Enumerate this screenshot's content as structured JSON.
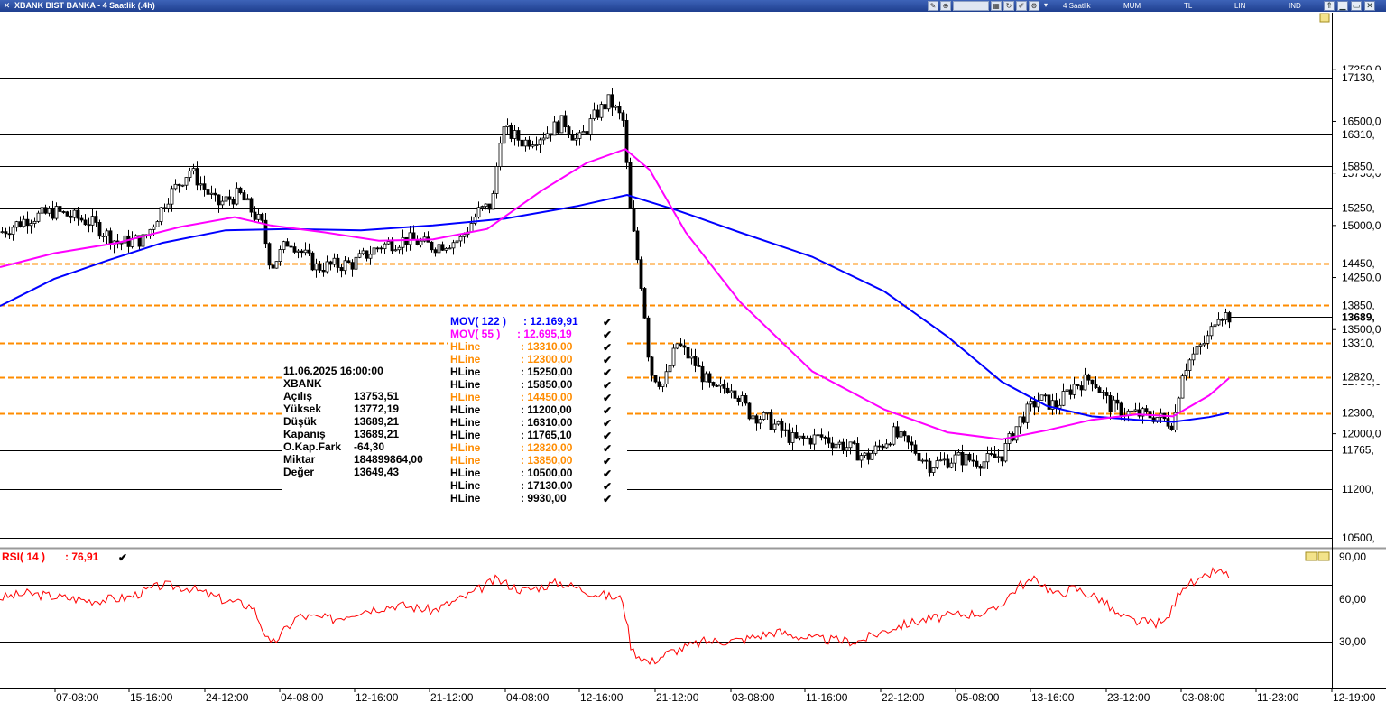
{
  "window": {
    "title": "XBANK BIST BANKA - 4 Saatlik (.4h)",
    "period_label": "4 Saatlik",
    "chart_type_label": "MUM",
    "currency_label": "TL",
    "scale_label": "LIN",
    "indicator_label": "IND"
  },
  "price_axis": {
    "ticks": [
      "17250,0",
      "16500,0",
      "15750,0",
      "15000,0",
      "14250,0",
      "13500,0",
      "12750,0",
      "12000,0"
    ],
    "current_price_label": "13689,",
    "hline_labels": [
      "17130,",
      "16310,",
      "15850,",
      "15250,",
      "14450,",
      "13850,",
      "13310,",
      "12820,",
      "12300,",
      "11765,",
      "11200,",
      "10500,"
    ]
  },
  "time_axis": {
    "labels": [
      "07-08:00",
      "15-16:00",
      "24-12:00",
      "04-08:00",
      "12-16:00",
      "21-12:00",
      "04-08:00",
      "12-16:00",
      "21-12:00",
      "03-08:00",
      "11-16:00",
      "22-12:00",
      "05-08:00",
      "13-16:00",
      "23-12:00",
      "03-08:00",
      "11-23:00",
      "12-19:00"
    ]
  },
  "legend": {
    "items": [
      {
        "name": "MOV( 122 )",
        "value": ": 12.169,91",
        "color": "#0000ff"
      },
      {
        "name": "MOV( 55 )",
        "value": ": 12.695,19",
        "color": "#ff00ff"
      },
      {
        "name": "HLine",
        "value": ": 13310,00",
        "color": "#ff8c00"
      },
      {
        "name": "HLine",
        "value": ": 12300,00",
        "color": "#ff8c00"
      },
      {
        "name": "HLine",
        "value": ": 15250,00",
        "color": "#000000"
      },
      {
        "name": "HLine",
        "value": ": 15850,00",
        "color": "#000000"
      },
      {
        "name": "HLine",
        "value": ": 14450,00",
        "color": "#ff8c00"
      },
      {
        "name": "HLine",
        "value": ": 11200,00",
        "color": "#000000"
      },
      {
        "name": "HLine",
        "value": ": 16310,00",
        "color": "#000000"
      },
      {
        "name": "HLine",
        "value": ": 11765,10",
        "color": "#000000"
      },
      {
        "name": "HLine",
        "value": ": 12820,00",
        "color": "#ff8c00"
      },
      {
        "name": "HLine",
        "value": ": 13850,00",
        "color": "#ff8c00"
      },
      {
        "name": "HLine",
        "value": ": 10500,00",
        "color": "#000000"
      },
      {
        "name": "HLine",
        "value": ": 17130,00",
        "color": "#000000"
      },
      {
        "name": "HLine",
        "value": ": 9930,00",
        "color": "#000000"
      }
    ]
  },
  "info_box": {
    "datetime": "11.06.2025  16:00:00",
    "symbol": "XBANK",
    "rows": [
      {
        "label": "Açılış",
        "value": "13753,51"
      },
      {
        "label": "Yüksek",
        "value": "13772,19"
      },
      {
        "label": "Düşük",
        "value": "13689,21"
      },
      {
        "label": "Kapanış",
        "value": "13689,21"
      },
      {
        "label": "O.Kap.Fark",
        "value": "-64,30"
      },
      {
        "label": "Miktar",
        "value": "184899864,00"
      },
      {
        "label": "Değer",
        "value": "13649,43"
      }
    ]
  },
  "rsi": {
    "label": "RSI( 14 )",
    "value": ": 76,91",
    "ticks": [
      "90,00",
      "60,00",
      "30,00"
    ],
    "color": "#ff0000"
  },
  "chart_data": {
    "type": "line",
    "title": "XBANK BIST BANKA - 4 Saatlik (.4h)",
    "hlines_solid": [
      17130,
      16310,
      15850,
      15250,
      11765.1,
      11200,
      10500
    ],
    "hlines_dashed": [
      14450,
      13850,
      13310,
      12820,
      12300
    ],
    "ma_slow": {
      "name": "MOV( 122 )",
      "value": 12169.91,
      "color": "#0000ff",
      "points": [
        [
          0,
          13840
        ],
        [
          60,
          14230
        ],
        [
          120,
          14500
        ],
        [
          180,
          14750
        ],
        [
          250,
          14930
        ],
        [
          320,
          14950
        ],
        [
          400,
          14930
        ],
        [
          480,
          15000
        ],
        [
          560,
          15100
        ],
        [
          640,
          15280
        ],
        [
          695,
          15440
        ],
        [
          750,
          15220
        ],
        [
          820,
          14900
        ],
        [
          900,
          14550
        ],
        [
          980,
          14050
        ],
        [
          1050,
          13400
        ],
        [
          1110,
          12750
        ],
        [
          1160,
          12400
        ],
        [
          1210,
          12250
        ],
        [
          1260,
          12200
        ],
        [
          1300,
          12170
        ],
        [
          1340,
          12240
        ],
        [
          1362,
          12300
        ]
      ]
    },
    "ma_fast": {
      "name": "MOV( 55 )",
      "value": 12695.19,
      "color": "#ff00ff",
      "points": [
        [
          0,
          14400
        ],
        [
          60,
          14600
        ],
        [
          130,
          14750
        ],
        [
          200,
          14980
        ],
        [
          260,
          15120
        ],
        [
          300,
          15000
        ],
        [
          360,
          14900
        ],
        [
          420,
          14780
        ],
        [
          480,
          14800
        ],
        [
          540,
          14950
        ],
        [
          600,
          15500
        ],
        [
          650,
          15900
        ],
        [
          693,
          16100
        ],
        [
          720,
          15800
        ],
        [
          760,
          14900
        ],
        [
          820,
          13900
        ],
        [
          900,
          12900
        ],
        [
          980,
          12350
        ],
        [
          1050,
          12020
        ],
        [
          1110,
          11920
        ],
        [
          1160,
          12050
        ],
        [
          1210,
          12200
        ],
        [
          1260,
          12280
        ],
        [
          1300,
          12250
        ],
        [
          1340,
          12550
        ],
        [
          1362,
          12800
        ]
      ]
    },
    "price_points": [
      [
        0,
        14900
      ],
      [
        30,
        15100
      ],
      [
        60,
        15200
      ],
      [
        100,
        15050
      ],
      [
        130,
        14750
      ],
      [
        160,
        14800
      ],
      [
        185,
        15400
      ],
      [
        210,
        15800
      ],
      [
        240,
        15300
      ],
      [
        265,
        15450
      ],
      [
        290,
        15000
      ],
      [
        300,
        14400
      ],
      [
        320,
        14800
      ],
      [
        350,
        14400
      ],
      [
        390,
        14450
      ],
      [
        420,
        14700
      ],
      [
        450,
        14800
      ],
      [
        480,
        14700
      ],
      [
        510,
        14800
      ],
      [
        530,
        15200
      ],
      [
        545,
        15300
      ],
      [
        555,
        16400
      ],
      [
        580,
        16200
      ],
      [
        600,
        16300
      ],
      [
        625,
        16500
      ],
      [
        640,
        16200
      ],
      [
        660,
        16600
      ],
      [
        675,
        16800
      ],
      [
        690,
        16500
      ],
      [
        698,
        15200
      ],
      [
        712,
        14000
      ],
      [
        720,
        12900
      ],
      [
        735,
        12700
      ],
      [
        750,
        13300
      ],
      [
        770,
        13000
      ],
      [
        790,
        12600
      ],
      [
        810,
        12700
      ],
      [
        830,
        12300
      ],
      [
        850,
        12200
      ],
      [
        880,
        11900
      ],
      [
        910,
        11950
      ],
      [
        940,
        11800
      ],
      [
        960,
        11650
      ],
      [
        990,
        12000
      ],
      [
        1010,
        11800
      ],
      [
        1030,
        11550
      ],
      [
        1060,
        11650
      ],
      [
        1090,
        11600
      ],
      [
        1110,
        11700
      ],
      [
        1130,
        12200
      ],
      [
        1150,
        12500
      ],
      [
        1170,
        12400
      ],
      [
        1190,
        12700
      ],
      [
        1210,
        12800
      ],
      [
        1230,
        12400
      ],
      [
        1250,
        12300
      ],
      [
        1280,
        12250
      ],
      [
        1300,
        12150
      ],
      [
        1310,
        12900
      ],
      [
        1320,
        13100
      ],
      [
        1340,
        13400
      ],
      [
        1348,
        13750
      ],
      [
        1362,
        13690
      ]
    ],
    "price_ylim": [
      9930,
      17250
    ],
    "rsi_points": [
      [
        0,
        61
      ],
      [
        30,
        64
      ],
      [
        60,
        62
      ],
      [
        100,
        59
      ],
      [
        140,
        61
      ],
      [
        180,
        70
      ],
      [
        210,
        68
      ],
      [
        250,
        59
      ],
      [
        280,
        55
      ],
      [
        300,
        27
      ],
      [
        330,
        48
      ],
      [
        370,
        46
      ],
      [
        400,
        52
      ],
      [
        440,
        56
      ],
      [
        480,
        52
      ],
      [
        520,
        63
      ],
      [
        550,
        74
      ],
      [
        580,
        66
      ],
      [
        620,
        72
      ],
      [
        660,
        64
      ],
      [
        690,
        60
      ],
      [
        700,
        24
      ],
      [
        720,
        15
      ],
      [
        740,
        22
      ],
      [
        780,
        30
      ],
      [
        820,
        31
      ],
      [
        860,
        37
      ],
      [
        900,
        32
      ],
      [
        950,
        30
      ],
      [
        990,
        40
      ],
      [
        1020,
        45
      ],
      [
        1060,
        49
      ],
      [
        1100,
        51
      ],
      [
        1130,
        70
      ],
      [
        1150,
        74
      ],
      [
        1170,
        63
      ],
      [
        1190,
        68
      ],
      [
        1220,
        60
      ],
      [
        1240,
        48
      ],
      [
        1260,
        44
      ],
      [
        1290,
        43
      ],
      [
        1300,
        54
      ],
      [
        1310,
        70
      ],
      [
        1330,
        72
      ],
      [
        1345,
        80
      ],
      [
        1362,
        77
      ]
    ],
    "rsi_ylim": [
      0,
      100
    ]
  }
}
